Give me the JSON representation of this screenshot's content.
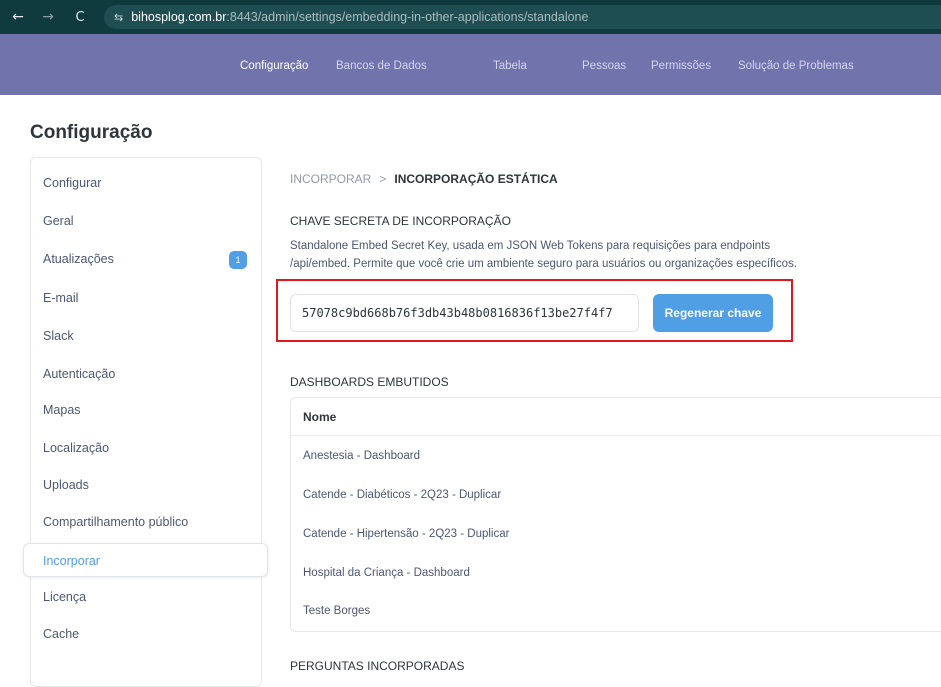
{
  "browser": {
    "back": "←",
    "forward": "→",
    "reload": "C",
    "site_icon": "⇆",
    "url_host": "bihosplog.com.br",
    "url_rest": ":8443/admin/settings/embedding-in-other-applications/standalone"
  },
  "app_nav": {
    "items": [
      {
        "label": "Configuração",
        "active": true
      },
      {
        "label": "Bancos de Dados",
        "active": false
      },
      {
        "label": "Tabela",
        "active": false
      },
      {
        "label": "Pessoas",
        "active": false
      },
      {
        "label": "Permissões",
        "active": false
      },
      {
        "label": "Solução de Problemas",
        "active": false
      }
    ]
  },
  "page": {
    "title": "Configuração"
  },
  "sidebar": {
    "items": [
      {
        "label": "Configurar"
      },
      {
        "label": "Geral"
      },
      {
        "label": "Atualizações",
        "badge": "1"
      },
      {
        "label": "E-mail"
      },
      {
        "label": "Slack"
      },
      {
        "label": "Autenticação"
      },
      {
        "label": "Mapas"
      },
      {
        "label": "Localização"
      },
      {
        "label": "Uploads"
      },
      {
        "label": "Compartilhamento público"
      },
      {
        "label": "Incorporar",
        "active": true
      },
      {
        "label": "Licença"
      },
      {
        "label": "Cache"
      }
    ]
  },
  "breadcrumb": {
    "parent": "INCORPORAR",
    "separator": ">",
    "current": "INCORPORAÇÃO ESTÁTICA"
  },
  "secret_key": {
    "title": "CHAVE SECRETA DE INCORPORAÇÃO",
    "description_line1": "Standalone Embed Secret Key, usada em JSON Web Tokens para requisições para endpoints",
    "description_line2": "/api/embed. Permite que você crie um ambiente seguro para usuários ou organizações específicos.",
    "value": "57078c9bd668b76f3db43b48b0816836f13be27f4f7",
    "regenerate_label": "Regenerar chave",
    "highlight_color": "#e3161b"
  },
  "dashboards": {
    "title": "DASHBOARDS EMBUTIDOS",
    "column": "Nome",
    "rows": [
      "Anestesia - Dashboard",
      "Catende - Diabéticos - 2Q23 - Duplicar",
      "Catende - Hipertensão - 2Q23 - Duplicar",
      "Hospital da Criança - Dashboard",
      "Teste Borges"
    ]
  },
  "questions": {
    "title": "PERGUNTAS INCORPORADAS"
  },
  "colors": {
    "nav_bg": "#7173ad",
    "accent": "#509ee3",
    "browser_bg": "#0f3a3e"
  }
}
